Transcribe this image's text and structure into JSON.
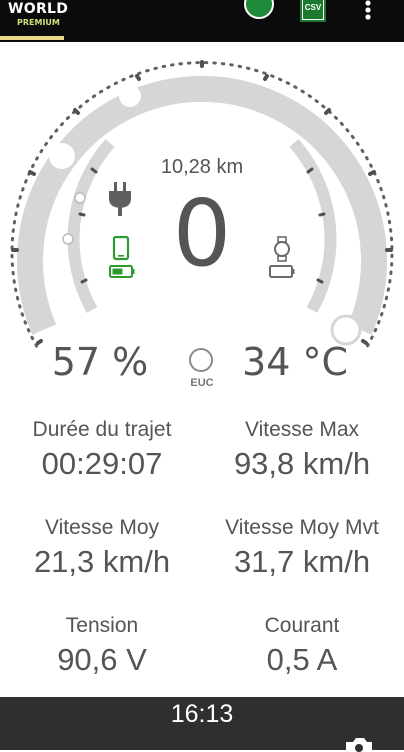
{
  "topbar": {
    "brand": "WORLD",
    "brand_sub": "PREMIUM",
    "csv_label": "CSV"
  },
  "gauge": {
    "distance": "10,28 km",
    "speed": "0",
    "battery": "57 %",
    "temperature": "34 °C",
    "euc_label": "EUC",
    "phone_icon_color": "#2e9b2e"
  },
  "stats": {
    "trip_duration": {
      "label": "Durée du trajet",
      "value": "00:29:07"
    },
    "max_speed": {
      "label": "Vitesse Max",
      "value": "93,8 km/h"
    },
    "avg_speed": {
      "label": "Vitesse Moy",
      "value": "21,3 km/h"
    },
    "avg_moving_speed": {
      "label": "Vitesse Moy Mvt",
      "value": "31,7 km/h"
    },
    "voltage": {
      "label": "Tension",
      "value": "90,6 V"
    },
    "current": {
      "label": "Courant",
      "value": "0,5 A"
    }
  },
  "bottombar": {
    "time": "16:13"
  }
}
